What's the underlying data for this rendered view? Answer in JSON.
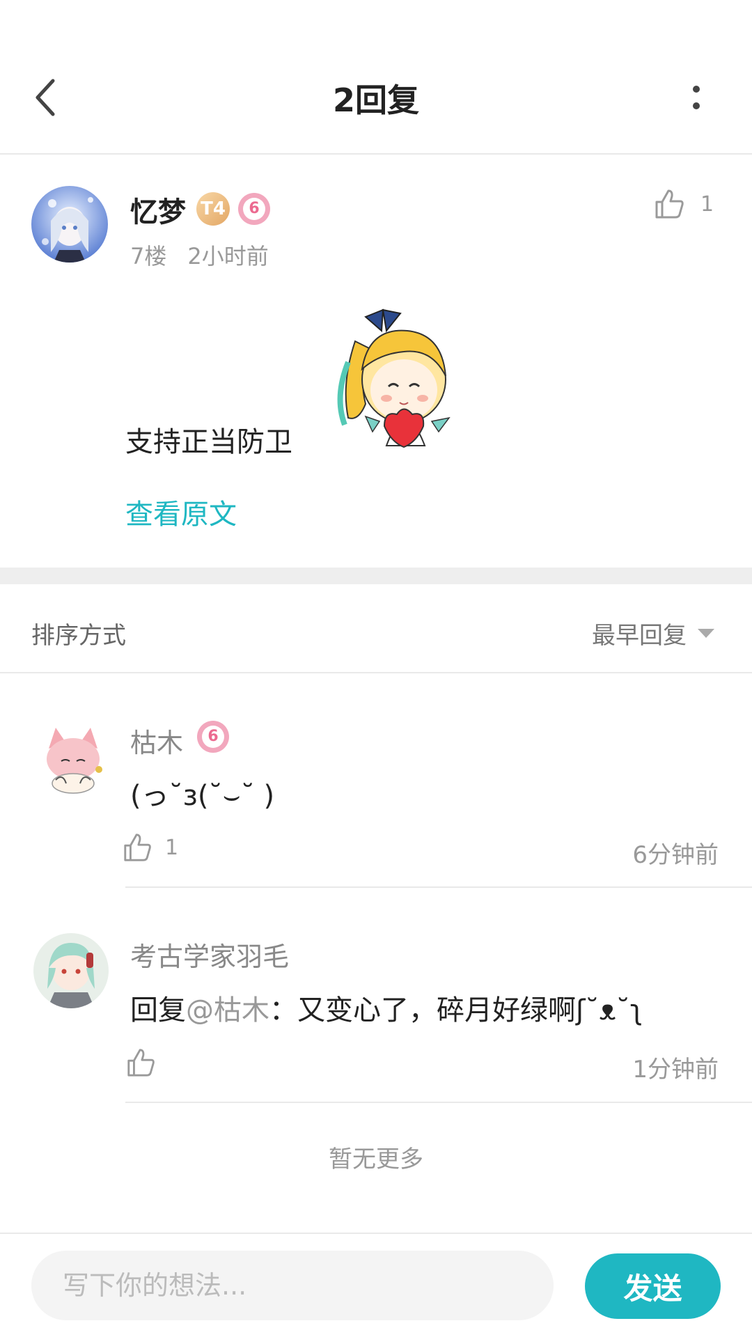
{
  "header": {
    "title": "2回复",
    "back_icon": "chevron-left-icon",
    "more_icon": "more-vertical-icon"
  },
  "main_post": {
    "username": "忆梦",
    "level_badge": "T4",
    "vip_badge": "6",
    "floor": "7楼",
    "time": "2小时前",
    "like_count": "1",
    "text": "支持正当防卫",
    "sticker": "chibi-heart-sticker",
    "view_original": "查看原文"
  },
  "sort": {
    "label": "排序方式",
    "selected": "最早回复"
  },
  "replies": [
    {
      "username": "枯木",
      "vip_badge": "6",
      "text": "(っ˘з(˘⌣˘ )",
      "like_count": "1",
      "time": "6分钟前"
    },
    {
      "username": "考古学家羽毛",
      "text_prefix": "回复",
      "mention": "@枯木",
      "text_body": "：又变心了，碎月好绿啊ʃ˘ᴥ˘ʅ",
      "time": "1分钟前"
    }
  ],
  "no_more": "暂无更多",
  "input": {
    "placeholder": "写下你的想法...",
    "send_label": "发送"
  },
  "colors": {
    "accent": "#1fb7c2",
    "vip_pink": "#ec6a90",
    "level_gold": "#e3a765"
  }
}
